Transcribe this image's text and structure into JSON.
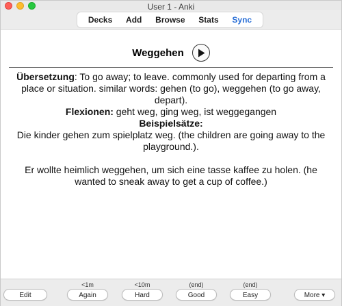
{
  "window": {
    "title": "User 1 - Anki"
  },
  "toolbar": {
    "items": [
      {
        "label": "Decks"
      },
      {
        "label": "Add"
      },
      {
        "label": "Browse"
      },
      {
        "label": "Stats"
      },
      {
        "label": "Sync"
      }
    ],
    "sync_color": "#2a6fd6"
  },
  "card": {
    "front_word": "Weggehen",
    "play_icon": "play-icon",
    "back": {
      "translation_label": "Übersetzung",
      "translation_text": ": To go away; to leave. commonly used for departing from a place or situation. similar words: gehen (to go), weggehen (to go away, depart).",
      "inflections_label": "Flexionen:",
      "inflections_text": " geht weg, ging weg, ist weggegangen",
      "examples_label": "Beispielsätze:",
      "example1": "Die kinder gehen zum spielplatz weg. (the children are going away to the playground.).",
      "example2": "Er wollte heimlich weggehen, um sich eine tasse kaffee zu holen. (he wanted to sneak away to get a cup of coffee.)"
    }
  },
  "answer_bar": {
    "edit": {
      "label": "Edit"
    },
    "again": {
      "label": "Again",
      "interval": "<1m"
    },
    "hard": {
      "label": "Hard",
      "interval": "<10m"
    },
    "good": {
      "label": "Good",
      "interval": "(end)"
    },
    "easy": {
      "label": "Easy",
      "interval": "(end)"
    },
    "more": {
      "label": "More ▾"
    }
  }
}
